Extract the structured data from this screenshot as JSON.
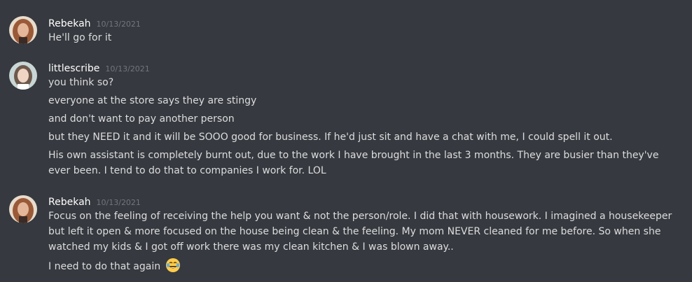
{
  "messages": [
    {
      "username": "Rebekah",
      "timestamp": "10/13/2021",
      "lines": [
        "He'll go for it"
      ]
    },
    {
      "username": "littlescribe",
      "timestamp": "10/13/2021",
      "lines": [
        "you think so?",
        "everyone at the store says they are stingy",
        "and don't want to pay another person",
        "but they NEED it and it will be SOOO good for business. If he'd just sit and have a chat with me, I could spell it out.",
        "His own assistant is completely burnt out, due to the work I have brought in the last 3 months. They are busier than they've ever been. I tend to do that to companies I work for. LOL"
      ]
    },
    {
      "username": "Rebekah",
      "timestamp": "10/13/2021",
      "lines": [
        "Focus on the feeling of receiving the help you want & not the person/role. I did that with housework. I imagined a housekeeper but left it open & more focused on the house being clean & the feeling. My mom  NEVER cleaned for me before. So when she watched my kids & I got off work there was my clean kitchen & I was blown away..",
        "I need to do that again"
      ]
    }
  ],
  "icons": {
    "laughing_emoji": "face-with-tears-of-joy-icon"
  }
}
